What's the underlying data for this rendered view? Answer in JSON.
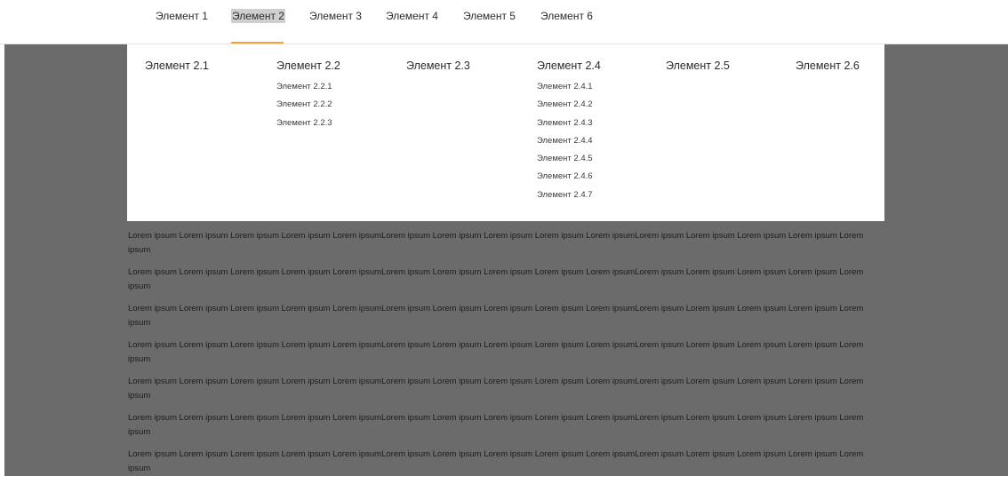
{
  "nav": {
    "items": [
      {
        "label": "Элемент 1"
      },
      {
        "label": "Элемент 2",
        "active": true
      },
      {
        "label": "Элемент 3"
      },
      {
        "label": "Элемент 4"
      },
      {
        "label": "Элемент 5"
      },
      {
        "label": "Элемент 6"
      }
    ],
    "active_underline_color": "#f0a43a"
  },
  "menu": {
    "columns": [
      {
        "title": "Элемент 2.1",
        "items": []
      },
      {
        "title": "Элемент 2.2",
        "items": [
          "Элемент 2.2.1",
          "Элемент 2.2.2",
          "Элемент 2.2.3"
        ]
      },
      {
        "title": "Элемент 2.3",
        "items": []
      },
      {
        "title": "Элемент 2.4",
        "items": [
          "Элемент 2.4.1",
          "Элемент 2.4.2",
          "Элемент 2.4.3",
          "Элемент 2.4.4",
          "Элемент 2.4.5",
          "Элемент 2.4.6",
          "Элемент 2.4.7"
        ]
      },
      {
        "title": "Элемент 2.5",
        "items": []
      },
      {
        "title": "Элемент 2.6",
        "items": []
      }
    ]
  },
  "content": {
    "paragraphs": [
      "Lorem ipsum Lorem ipsum Lorem ipsum Lorem ipsum Lorem ipsumLorem ipsum Lorem ipsum Lorem ipsum Lorem ipsum Lorem ipsumLorem ipsum Lorem ipsum Lorem ipsum Lorem ipsum Lorem ipsum",
      "Lorem ipsum Lorem ipsum Lorem ipsum Lorem ipsum Lorem ipsumLorem ipsum Lorem ipsum Lorem ipsum Lorem ipsum Lorem ipsumLorem ipsum Lorem ipsum Lorem ipsum Lorem ipsum Lorem ipsum",
      "Lorem ipsum Lorem ipsum Lorem ipsum Lorem ipsum Lorem ipsumLorem ipsum Lorem ipsum Lorem ipsum Lorem ipsum Lorem ipsumLorem ipsum Lorem ipsum Lorem ipsum Lorem ipsum Lorem ipsum",
      "Lorem ipsum Lorem ipsum Lorem ipsum Lorem ipsum Lorem ipsumLorem ipsum Lorem ipsum Lorem ipsum Lorem ipsum Lorem ipsumLorem ipsum Lorem ipsum Lorem ipsum Lorem ipsum Lorem ipsum",
      "Lorem ipsum Lorem ipsum Lorem ipsum Lorem ipsum Lorem ipsumLorem ipsum Lorem ipsum Lorem ipsum Lorem ipsum Lorem ipsumLorem ipsum Lorem ipsum Lorem ipsum Lorem ipsum Lorem ipsum",
      "Lorem ipsum Lorem ipsum Lorem ipsum Lorem ipsum Lorem ipsumLorem ipsum Lorem ipsum Lorem ipsum Lorem ipsum Lorem ipsumLorem ipsum Lorem ipsum Lorem ipsum Lorem ipsum Lorem ipsum",
      "Lorem ipsum Lorem ipsum Lorem ipsum Lorem ipsum Lorem ipsumLorem ipsum Lorem ipsum Lorem ipsum Lorem ipsum Lorem ipsumLorem ipsum Lorem ipsum Lorem ipsum Lorem ipsum Lorem ipsum"
    ]
  },
  "colors": {
    "overlay": "#6b6b6b",
    "menu_background": "#ffffff",
    "active_highlight": "#cfcfcf"
  }
}
